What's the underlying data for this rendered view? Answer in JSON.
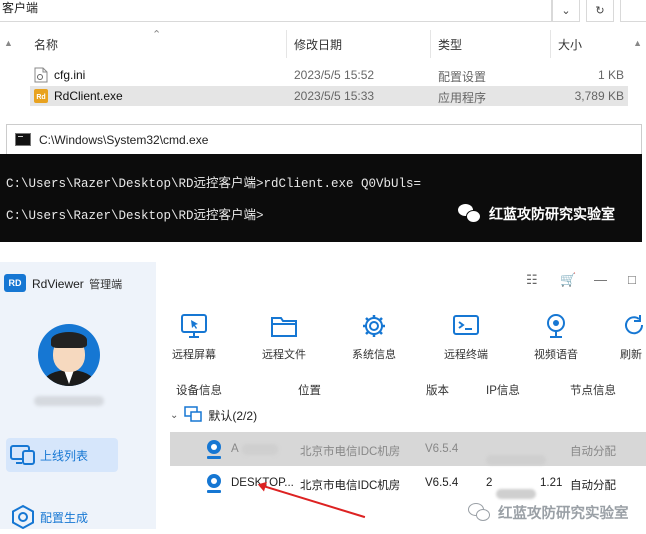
{
  "explorer": {
    "address_text": "客户端",
    "columns": {
      "name": "名称",
      "date": "修改日期",
      "type": "类型",
      "size": "大小"
    },
    "files": [
      {
        "name": "cfg.ini",
        "date": "2023/5/5 15:52",
        "type": "配置设置",
        "size": "1 KB",
        "icon": "ini-file-icon"
      },
      {
        "name": "RdClient.exe",
        "date": "2023/5/5 15:33",
        "type": "应用程序",
        "size": "3,789 KB",
        "icon": "exe-file-icon"
      }
    ]
  },
  "cmd": {
    "title": "C:\\Windows\\System32\\cmd.exe",
    "lines": [
      "C:\\Users\\Razer\\Desktop\\RD远控客户端>rdClient.exe Q0VbUls=",
      "C:\\Users\\Razer\\Desktop\\RD远控客户端>"
    ],
    "watermark": "红蓝攻防研究实验室"
  },
  "app": {
    "logo": "RD",
    "name": "RdViewer",
    "subtitle": "管理端",
    "sidebar": [
      {
        "label": "上线列表",
        "icon": "monitor-icon",
        "active": true
      },
      {
        "label": "配置生成",
        "icon": "settings-hex-icon",
        "active": false
      }
    ],
    "toolbar": [
      {
        "label": "远程屏幕",
        "icon": "remote-screen-icon"
      },
      {
        "label": "远程文件",
        "icon": "folder-icon"
      },
      {
        "label": "系统信息",
        "icon": "gear-icon"
      },
      {
        "label": "远程终端",
        "icon": "terminal-icon"
      },
      {
        "label": "视频语音",
        "icon": "webcam-icon"
      },
      {
        "label": "刷新",
        "icon": "refresh-icon"
      }
    ],
    "grid_headers": {
      "device": "设备信息",
      "location": "位置",
      "version": "版本",
      "ip": "IP信息",
      "node": "节点信息"
    },
    "group": {
      "label": "默认(2/2)"
    },
    "devices": [
      {
        "name": "A",
        "location": "北京市电信IDC机房",
        "version": "V6.5.4",
        "ip": "",
        "node": "自动分配",
        "highlighted": true
      },
      {
        "name": "DESKTOP...",
        "location": "北京市电信IDC机房",
        "version": "V6.5.4",
        "ip_prefix": "2",
        "ip_suffix": "1.21",
        "node": "自动分配",
        "highlighted": false
      }
    ],
    "watermark": "红蓝攻防研究实验室"
  }
}
